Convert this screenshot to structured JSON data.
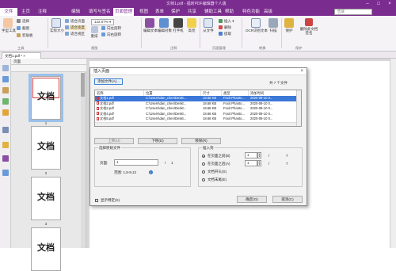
{
  "titlebar": {
    "title": "文档1.pdf - 福昕PDF编辑器个人版"
  },
  "menu": {
    "file": "文件",
    "items": [
      "主页",
      "注释",
      "编辑",
      "填写与签名",
      "页面管理",
      "视图",
      "表单",
      "保护",
      "共享",
      "辅助工具",
      "帮助",
      "特色功能",
      "高级"
    ],
    "active_index": 4,
    "search_placeholder": "告诉"
  },
  "ribbon": {
    "hand": "手型工具",
    "select": "选择",
    "snapshot": "截图",
    "clipboard": "剪贴板",
    "actual": "实际大小",
    "fit_page": "适合页面",
    "fit_width": "适合宽度",
    "fit_visible": "适合视区",
    "zoom": "122.07%",
    "rotate_left": "向左旋转",
    "rotate_right": "向右旋转",
    "reflow": "重排",
    "edit_text": "编辑文本",
    "edit_object": "编辑对象",
    "typewriter": "打字机",
    "highlight": "高亮",
    "insert": "插入",
    "delete": "删除",
    "extract": "提取",
    "from_file": "从文件",
    "ocr": "OCR识别文本",
    "scan": "扫描",
    "protect": "保护",
    "sign": "删除此文档签名",
    "groups": [
      "工具",
      "视图",
      "注释",
      "页面管理",
      "转换",
      "保护"
    ]
  },
  "doctab": "文档1.pdf *",
  "panel": {
    "title": "页面",
    "thumbs": [
      {
        "word": "文档",
        "num": "1"
      },
      {
        "word": "文档",
        "num": "2"
      },
      {
        "word": "文档",
        "num": "3"
      },
      {
        "word": "文档",
        "num": "4"
      },
      {
        "word": "文档",
        "num": ""
      }
    ]
  },
  "dialog": {
    "title": "插入页面",
    "add_files": "添加文件(A)...",
    "count": "共 7 个文件",
    "headers": [
      "名称",
      "位置",
      "尺寸",
      "类型",
      "添加时间"
    ],
    "rows": [
      [
        "文档1.pdf",
        "C:\\Users\\dan_chen\\Deskt...",
        "18.68 KB",
        "Foxit Phanto...",
        "2020-09-10 0..."
      ],
      [
        "文档2.pdf",
        "C:\\Users\\dan_chen\\Deskt...",
        "18.68 KB",
        "Foxit Phanto...",
        "2020-09-10 0..."
      ],
      [
        "文档3.pdf",
        "C:\\Users\\dan_chen\\Deskt...",
        "18.68 KB",
        "Foxit Phanto...",
        "2020-09-10 0..."
      ],
      [
        "文档4.pdf",
        "C:\\Users\\dan_chen\\Deskt...",
        "18.68 KB",
        "Foxit Phanto...",
        "2020-09-10 0..."
      ],
      [
        "文档5.pdf",
        "C:\\Users\\dan_chen\\Deskt...",
        "18.68 KB",
        "Foxit Phanto...",
        "2020-09-10 0..."
      ],
      [
        "文档6.pdf",
        "C:\\Users\\dan_chen\\Deskt...",
        "18.68 KB",
        "Foxit Phanto...",
        "2020-09-10 0..."
      ]
    ],
    "selected_row": 0,
    "move_up": "上移(U)",
    "move_down": "下移(D)",
    "remove": "移除(R)",
    "select_source": "选择原始文件",
    "page_label": "页面:",
    "page_value": "1",
    "page_slash": "/",
    "page_total": "1",
    "range": "范围: 1,5-9,12",
    "insert_to": "插入到",
    "opt_before": "在页面之前(B)",
    "opt_after": "在页面之后(A)",
    "opt_start": "文档开头(S)",
    "opt_end": "文档末尾(E)",
    "before_value": "1",
    "after_value": "1",
    "slash": "/",
    "total": "7",
    "show_settings": "显示特定(S)",
    "ok": "确定(O)",
    "cancel": "取消(C)"
  }
}
